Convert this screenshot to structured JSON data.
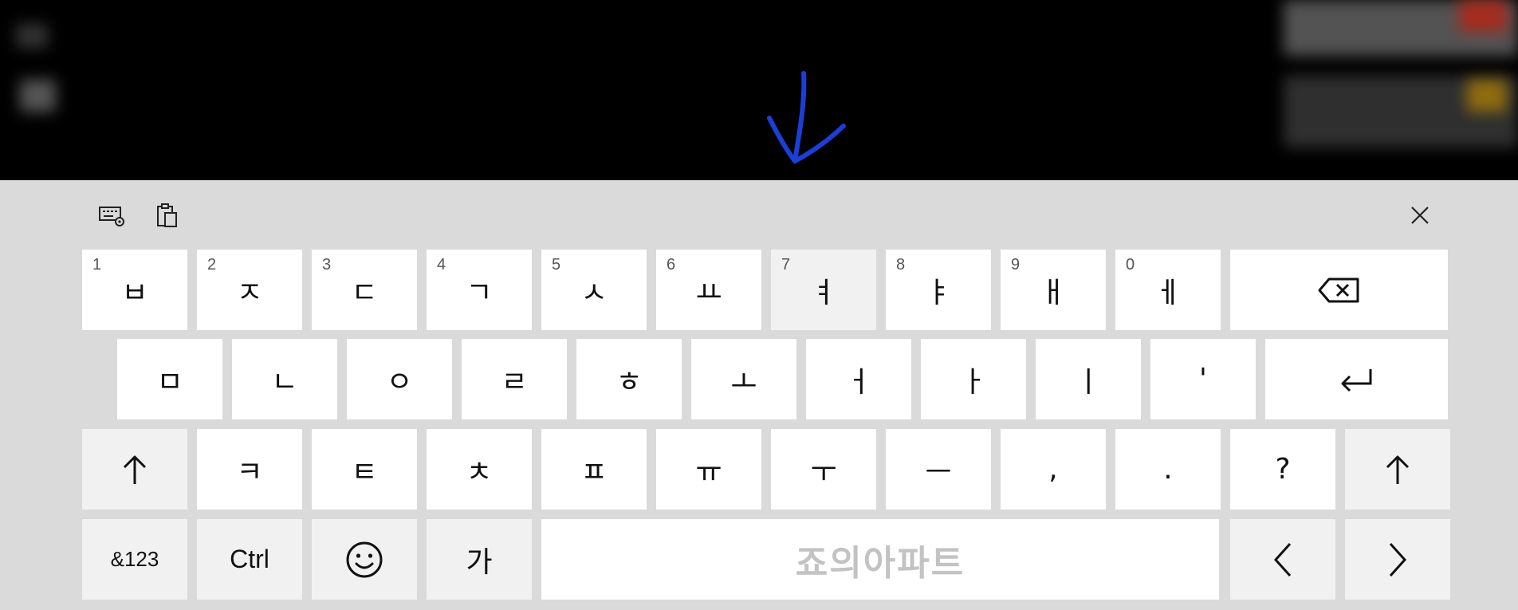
{
  "toolbar": {
    "settings_icon": "keyboard-settings-icon",
    "clipboard_icon": "clipboard-icon",
    "close_icon": "close-icon"
  },
  "rows": [
    [
      {
        "name": "key-bieup",
        "label": "ㅂ",
        "num": "1"
      },
      {
        "name": "key-jieut",
        "label": "ㅈ",
        "num": "2"
      },
      {
        "name": "key-digeut",
        "label": "ㄷ",
        "num": "3"
      },
      {
        "name": "key-giyeok",
        "label": "ㄱ",
        "num": "4"
      },
      {
        "name": "key-siot",
        "label": "ㅅ",
        "num": "5"
      },
      {
        "name": "key-yo",
        "label": "ㅛ",
        "num": "6"
      },
      {
        "name": "key-yeo",
        "label": "ㅕ",
        "num": "7",
        "pressed": true
      },
      {
        "name": "key-ya",
        "label": "ㅑ",
        "num": "8"
      },
      {
        "name": "key-ae",
        "label": "ㅐ",
        "num": "9"
      },
      {
        "name": "key-e",
        "label": "ㅔ",
        "num": "0"
      },
      {
        "name": "backspace-key",
        "icon": "backspace-icon"
      }
    ],
    [
      {
        "name": "key-mieum",
        "label": "ㅁ"
      },
      {
        "name": "key-nieun",
        "label": "ㄴ"
      },
      {
        "name": "key-ieung",
        "label": "ㅇ"
      },
      {
        "name": "key-rieul",
        "label": "ㄹ"
      },
      {
        "name": "key-hieut",
        "label": "ㅎ"
      },
      {
        "name": "key-o",
        "label": "ㅗ"
      },
      {
        "name": "key-eo",
        "label": "ㅓ"
      },
      {
        "name": "key-a",
        "label": "ㅏ"
      },
      {
        "name": "key-i",
        "label": "ㅣ"
      },
      {
        "name": "key-apostrophe",
        "label": "'"
      },
      {
        "name": "enter-key",
        "icon": "enter-icon"
      }
    ],
    [
      {
        "name": "shift-left-key",
        "icon": "shift-icon",
        "gray": true
      },
      {
        "name": "key-kieuk",
        "label": "ㅋ"
      },
      {
        "name": "key-tieut",
        "label": "ㅌ"
      },
      {
        "name": "key-chieut",
        "label": "ㅊ"
      },
      {
        "name": "key-pieup",
        "label": "ㅍ"
      },
      {
        "name": "key-yu",
        "label": "ㅠ"
      },
      {
        "name": "key-u",
        "label": "ㅜ"
      },
      {
        "name": "key-eu",
        "label": "ㅡ"
      },
      {
        "name": "key-comma",
        "label": ","
      },
      {
        "name": "key-period",
        "label": "."
      },
      {
        "name": "key-question",
        "label": "?"
      },
      {
        "name": "shift-right-key",
        "icon": "shift-icon",
        "gray": true
      }
    ],
    [
      {
        "name": "symbols-key",
        "label": "&123",
        "gray": true
      },
      {
        "name": "ctrl-key",
        "label": "Ctrl",
        "gray": true
      },
      {
        "name": "emoji-key",
        "icon": "smiley-icon",
        "gray": true
      },
      {
        "name": "language-key",
        "label": "가",
        "gray": true
      },
      {
        "name": "space-key",
        "label": "죠의아파트"
      },
      {
        "name": "left-arrow-key",
        "icon": "chevron-left-icon",
        "gray": true
      },
      {
        "name": "right-arrow-key",
        "icon": "chevron-right-icon",
        "gray": true
      }
    ]
  ],
  "colors": {
    "keyboard_bg": "#dadada",
    "key_bg": "#ffffff",
    "key_gray_bg": "#f1f1f1",
    "arrow_annotation": "#1b3fd6"
  }
}
